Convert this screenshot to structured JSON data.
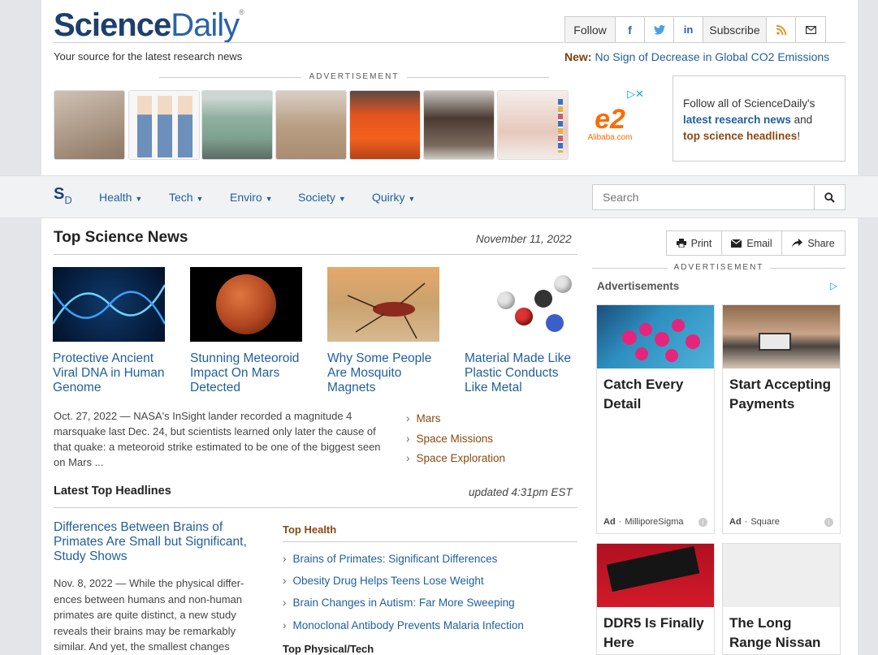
{
  "header": {
    "logo_bold": "Science",
    "logo_light": "Daily",
    "tagline": "Your source for the latest research news",
    "follow_label": "Follow",
    "subscribe_label": "Subscribe",
    "new_label": "New:",
    "new_link": "No Sign of Decrease in Global CO2 Emissions",
    "social_icons": [
      "facebook-icon",
      "twitter-icon",
      "linkedin-icon",
      "rss-icon",
      "email-icon"
    ]
  },
  "top_ad": {
    "label": "ADVERTISEMENT",
    "brand": "Alibaba.com"
  },
  "follow_box": {
    "line1": "Follow all of ScienceDaily's",
    "link1": "latest research news",
    "mid": " and",
    "link2": "top science headlines",
    "end": "!"
  },
  "nav": {
    "logo_s": "S",
    "logo_d": "D",
    "items": [
      "Health",
      "Tech",
      "Enviro",
      "Society",
      "Quirky"
    ],
    "search_placeholder": "Search"
  },
  "top_news": {
    "heading": "Top Science News",
    "date": "November 11, 2022",
    "stories": [
      {
        "title": "Protective Ancient Viral DNA in Human Genome"
      },
      {
        "title": "Stunning Meteoroid Impact On Mars Detected"
      },
      {
        "title": "Why Some People Are Mosquito Magnets"
      },
      {
        "title": "Material Made Like Plastic Conducts Like Metal"
      }
    ],
    "summary": "Oct. 27, 2022 — NASA's InSight lander recorded a magnitude 4 marsquake last Dec. 24, but scientists learned only later the cause of that quake: a meteoroid strike estimated to be one of the big­gest seen on Mars ...",
    "related": [
      "Mars",
      "Space Missions",
      "Space Exploration"
    ]
  },
  "headlines": {
    "heading": "Latest Top Headlines",
    "updated": "updated 4:31pm EST",
    "lead_title": "Differences Between Brains of Primates Are Small but Significant, Study Shows",
    "lead_summary": "Nov. 8, 2022 — While the physical differ­ences between humans and non-human primates are quite distinct, a new study reveals their brains may be remarkably similar. And yet, the smallest changes",
    "section1": "Top Health",
    "items": [
      "Brains of Primates: Significant Differences",
      "Obesity Drug Helps Teens Lose Weight",
      "Brain Changes in Autism: Far More Sweeping",
      "Monoclonal Antibody Prevents Malaria Infection"
    ],
    "section2": "Top Physical/Tech"
  },
  "sidebar": {
    "print": "Print",
    "email": "Email",
    "share": "Share",
    "ad_label": "ADVERTISEMENT",
    "ads_heading": "Advertisements",
    "ads": [
      {
        "title": "Catch Every Detail",
        "ad": "Ad",
        "source": "MilliporeSigma"
      },
      {
        "title": "Start Accepting Payments",
        "ad": "Ad",
        "source": "Square"
      },
      {
        "title": "DDR5 Is Finally Here"
      },
      {
        "title": "The Long Range Nissan"
      }
    ]
  }
}
